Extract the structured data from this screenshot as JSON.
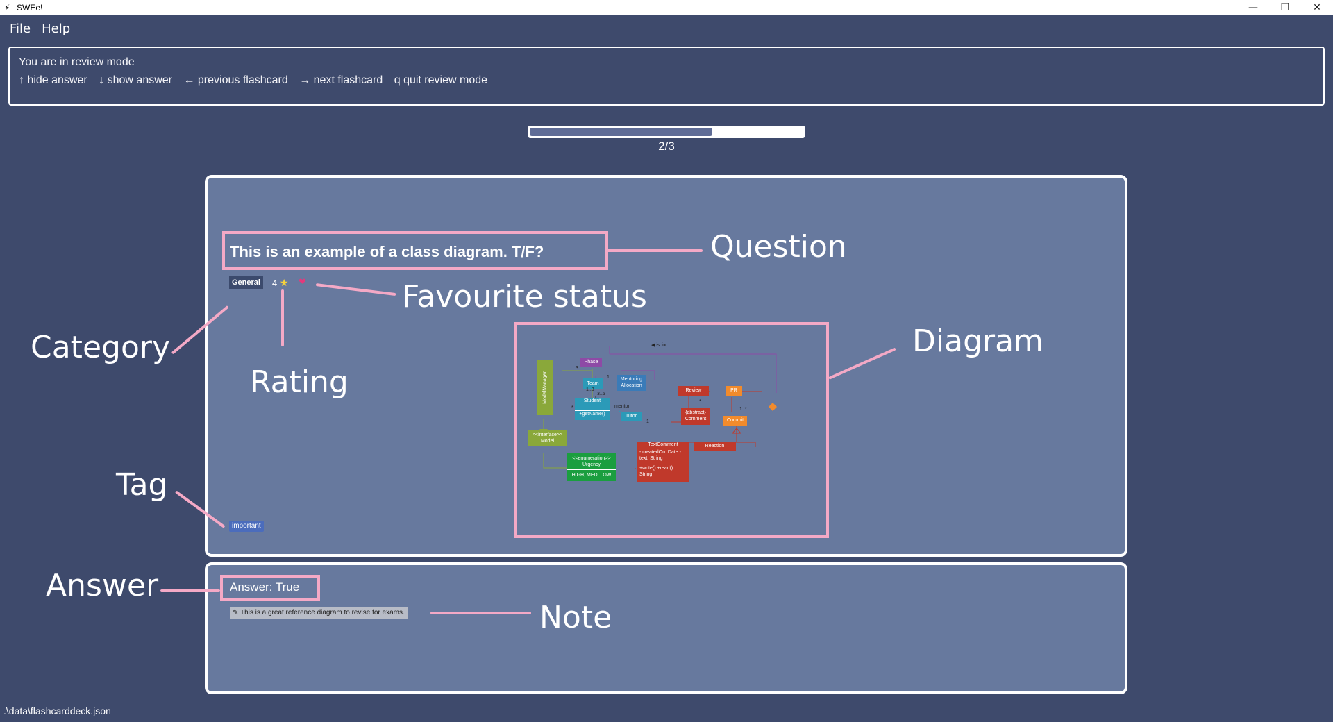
{
  "window": {
    "title": "SWEe!",
    "app_icon": "lightning-icon",
    "controls": {
      "minimize": "—",
      "restore": "❐",
      "close": "✕"
    }
  },
  "menu": {
    "file": "File",
    "help": "Help"
  },
  "result": {
    "line1": "You are in review mode",
    "keys": [
      "↑ hide answer",
      "↓ show answer",
      "← previous flashcard",
      "→ next flashcard",
      "q quit review mode"
    ]
  },
  "progress": {
    "fraction": 0.667,
    "text": "2/3"
  },
  "card": {
    "question": "This is an example of a class diagram. T/F?",
    "category": "General",
    "rating": "4",
    "rating_icon": "star-icon",
    "favourite_icon": "heart-icon",
    "tag": "important"
  },
  "diagram": {
    "is_for": "◀ is for",
    "model_manager": "ModelManager",
    "phase": "Phase",
    "team": "Team",
    "mentoring_allocation": "Mentoring Allocation",
    "student": "Student",
    "get_name": "+getName()",
    "tutor": "Tutor",
    "mentor": "mentor",
    "review": "Review",
    "pr": "PR",
    "commit": "Commit",
    "comment": "{abstract} Comment",
    "text_comment": "TextComment",
    "text_comment_attrs": "- createdOn: Date - text: String",
    "text_comment_ops": "+write() +read(): String",
    "reaction": "Reaction",
    "model": "<<interface>> Model",
    "urgency": "<<enumeration>> Urgency",
    "urgency_values": "HIGH, MED, LOW",
    "mult_3": "3",
    "mult_1": "1",
    "mult_1_3": "1..3",
    "mult_3_5": "3..5",
    "mult_star": "*",
    "mult_1b": "1",
    "mult_star2": "*",
    "mult_1_star": "1..*"
  },
  "answer": {
    "text": "Answer: True",
    "note": "✎ This is a great reference diagram to revise for exams."
  },
  "annotations": {
    "question": "Question",
    "favourite": "Favourite status",
    "category": "Category",
    "rating": "Rating",
    "diagram": "Diagram",
    "tag": "Tag",
    "answer": "Answer",
    "note": "Note"
  },
  "colors": {
    "background": "#3e4a6c",
    "card": "#67799e",
    "annotation": "#f4a9c6"
  },
  "status": {
    "path": ".\\data\\flashcarddeck.json"
  }
}
